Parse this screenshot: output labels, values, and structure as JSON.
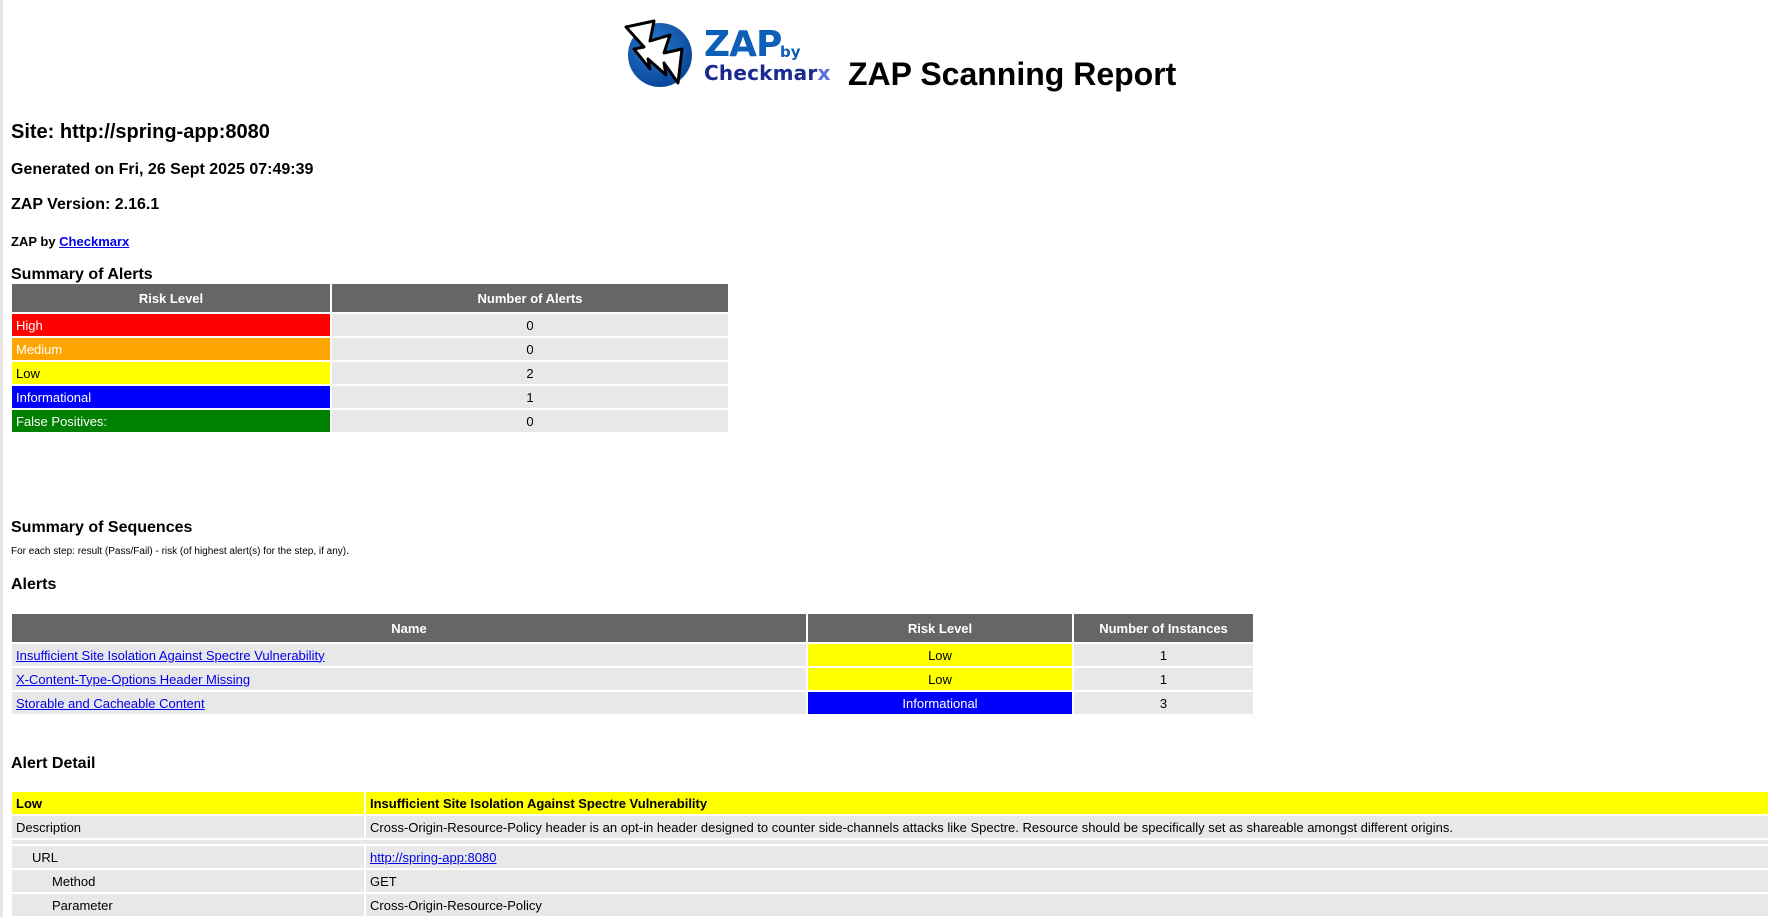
{
  "header": {
    "logo": {
      "zap": "ZAP",
      "by": "by",
      "checkmarx": "Checkmar",
      "checkmarx_x": "x"
    },
    "title": "ZAP Scanning Report"
  },
  "site": "Site: http://spring-app:8080",
  "generated": "Generated on Fri, 26 Sept 2025 07:49:39",
  "version": "ZAP Version: 2.16.1",
  "zap_by": {
    "prefix": "ZAP by ",
    "link": "Checkmarx"
  },
  "summary_alerts": {
    "title": "Summary of Alerts",
    "headers": [
      "Risk Level",
      "Number of Alerts"
    ],
    "rows": [
      {
        "level": "High",
        "count": "0"
      },
      {
        "level": "Medium",
        "count": "0"
      },
      {
        "level": "Low",
        "count": "2"
      },
      {
        "level": "Informational",
        "count": "1"
      },
      {
        "level": "False Positives:",
        "count": "0"
      }
    ]
  },
  "summary_sequences": {
    "title": "Summary of Sequences",
    "note": "For each step: result (Pass/Fail) - risk (of highest alert(s) for the step, if any)."
  },
  "alerts": {
    "title": "Alerts",
    "headers": [
      "Name",
      "Risk Level",
      "Number of Instances"
    ],
    "rows": [
      {
        "name": "Insufficient Site Isolation Against Spectre Vulnerability",
        "risk": "Low",
        "instances": "1"
      },
      {
        "name": "X-Content-Type-Options Header Missing",
        "risk": "Low",
        "instances": "1"
      },
      {
        "name": "Storable and Cacheable Content",
        "risk": "Informational",
        "instances": "3"
      }
    ]
  },
  "alert_detail": {
    "title": "Alert Detail",
    "risk": "Low",
    "name": "Insufficient Site Isolation Against Spectre Vulnerability",
    "description_label": "Description",
    "description": "Cross-Origin-Resource-Policy header is an opt-in header designed to counter side-channels attacks like Spectre. Resource should be specifically set as shareable amongst different origins.",
    "url_label": "URL",
    "url": "http://spring-app:8080",
    "method_label": "Method",
    "method": "GET",
    "parameter_label": "Parameter",
    "parameter": "Cross-Origin-Resource-Policy"
  },
  "colors": {
    "high": "#ff0000",
    "medium": "#ffa500",
    "low": "#ffff00",
    "informational": "#0000ff",
    "false_positive": "#008000",
    "header_gray": "#666666"
  }
}
